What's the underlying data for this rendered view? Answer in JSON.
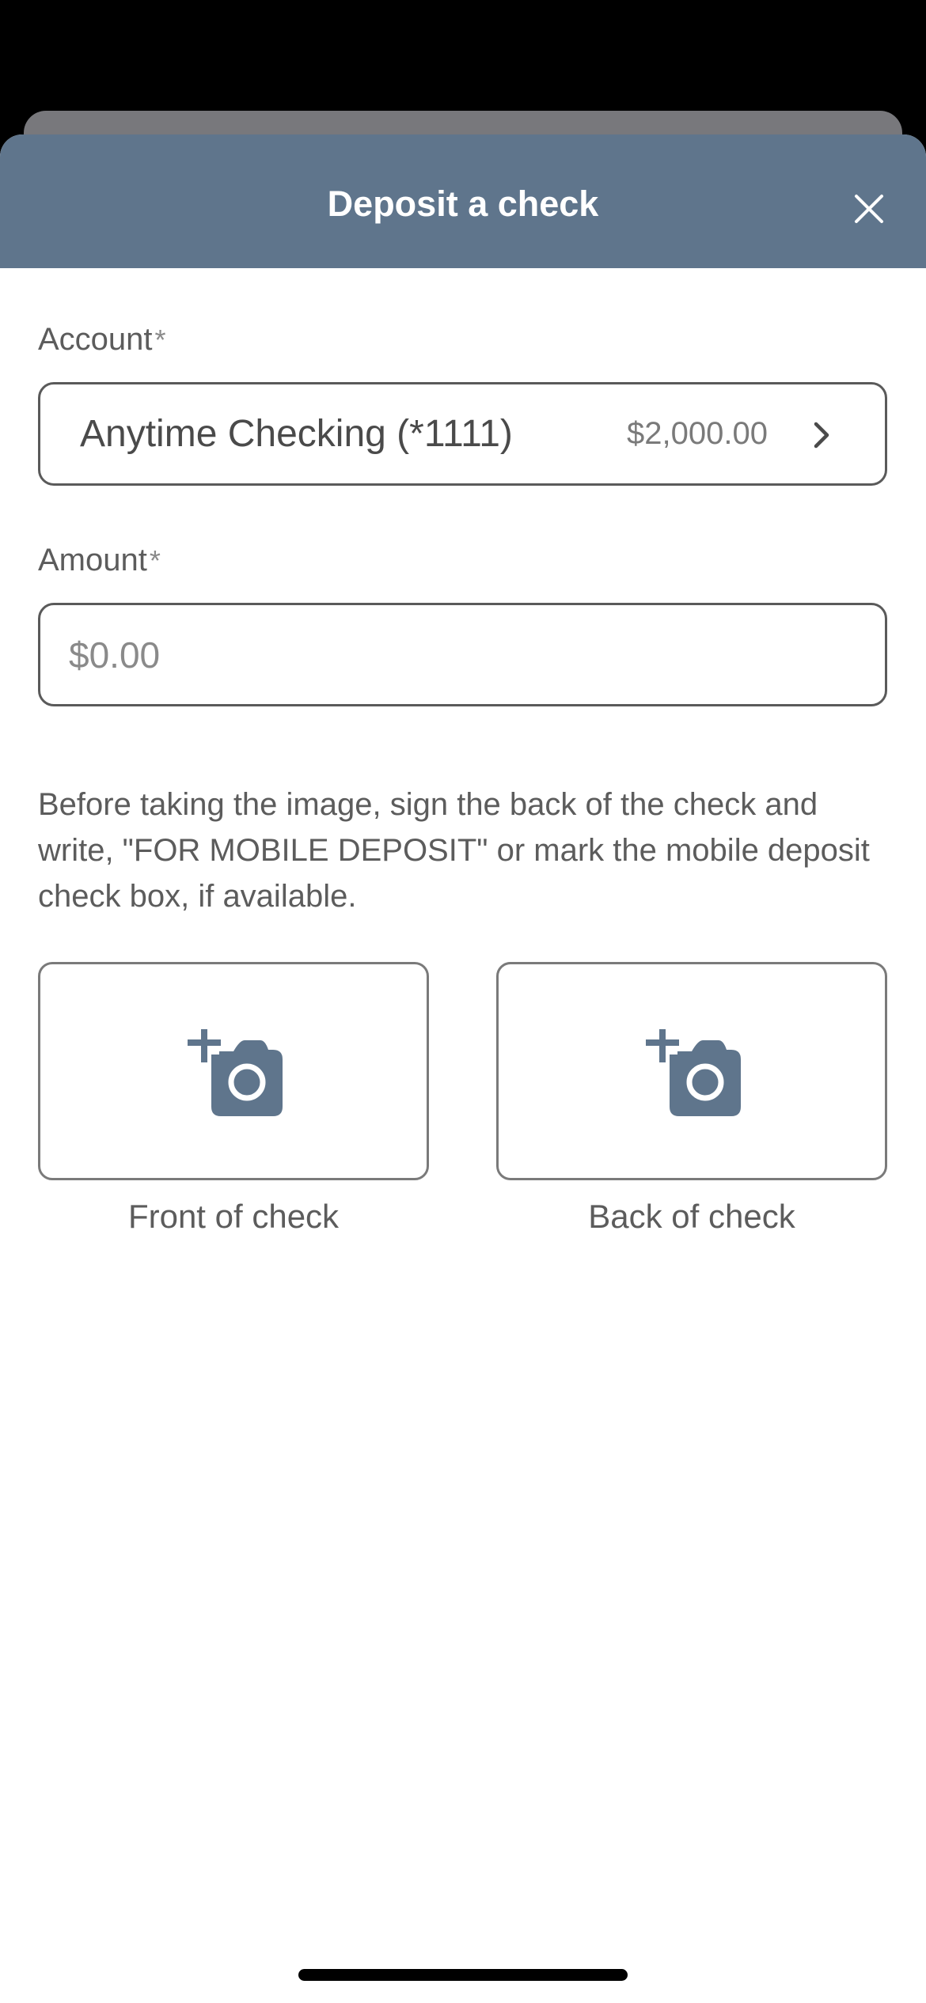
{
  "header": {
    "title": "Deposit a check"
  },
  "account": {
    "label": "Account",
    "required_marker": "*",
    "name": "Anytime Checking (*1111)",
    "balance": "$2,000.00"
  },
  "amount": {
    "label": "Amount",
    "required_marker": "*",
    "value": "",
    "placeholder": "$0.00"
  },
  "instructions": "Before taking the image, sign the back of the check and write, \"FOR MOBILE DEPOSIT\" or mark the mobile deposit check box, if available.",
  "capture": {
    "front_label": "Front of check",
    "back_label": "Back of check"
  },
  "icons": {
    "close": "close-icon",
    "chevron": "chevron-right-icon",
    "camera": "add-photo-camera-icon"
  },
  "colors": {
    "header_bg": "#5f758c",
    "icon_fill": "#5f758c",
    "text": "#5c5c5c",
    "border": "#5a5a5a"
  }
}
